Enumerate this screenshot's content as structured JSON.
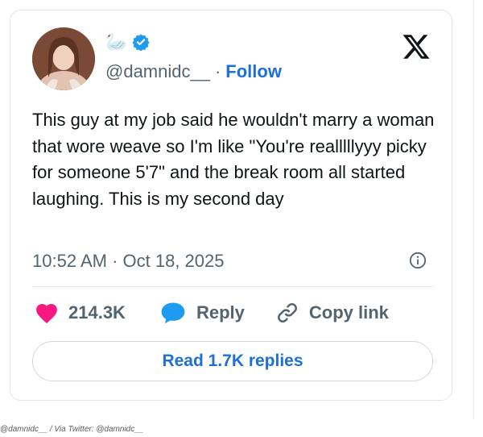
{
  "tweet": {
    "handle": "@damnidc__",
    "separator": "·",
    "follow_label": "Follow",
    "name_emoji": "🦢",
    "text": "This guy at my job said he wouldn't marry a woman that wore weave so I'm like \"You're realllllyyy picky for someone 5'7\" and the break room all started laughing. This is my second day",
    "timestamp": "10:52 AM · Oct 18, 2025",
    "likes": "214.3K",
    "reply_label": "Reply",
    "copy_link_label": "Copy link",
    "read_replies_label": "Read 1.7K replies"
  },
  "caption": "@damnidc__ / Via Twitter: @damnidc__",
  "colors": {
    "accent": "#1d70d8",
    "heart": "#f91880",
    "muted": "#536471",
    "text": "#0f1419"
  },
  "icons": [
    "verified-badge-icon",
    "x-logo-icon",
    "info-icon",
    "heart-icon",
    "reply-bubble-icon",
    "link-icon",
    "swan-emoji"
  ]
}
